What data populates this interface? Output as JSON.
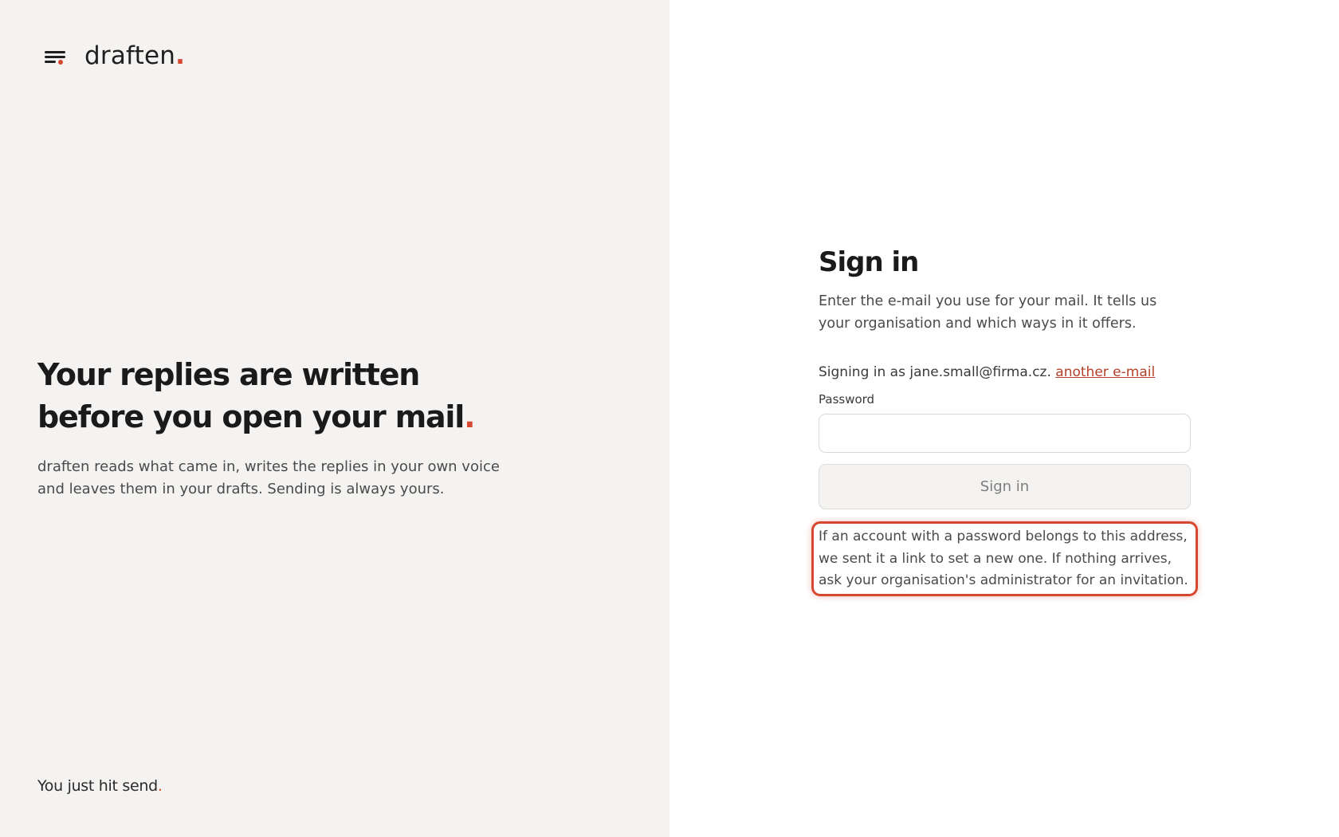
{
  "brand": {
    "name": "draften",
    "dot": ".",
    "icon": "menu-lines-icon"
  },
  "colors": {
    "accent": "#d6482f",
    "link": "#b3422a",
    "left_bg": "#f4f3f1"
  },
  "hero": {
    "title": "Your replies are written before you open your mail",
    "title_dot": ".",
    "subtitle": "draften reads what came in, writes the replies in your own voice and leaves them in your drafts. Sending is always yours."
  },
  "tagline": {
    "text": "You just hit send",
    "dot": "."
  },
  "signin": {
    "title": "Sign in",
    "description": "Enter the e-mail you use for your mail. It tells us your organisation and which ways in it offers.",
    "signing_as_prefix": "Signing in as jane.small@firma.cz.",
    "another_email_link": "another e-mail",
    "password_label": "Password",
    "password_value": "",
    "button_label": "Sign in",
    "notice": "If an account with a password belongs to this address, we sent it a link to set a new one. If nothing arrives, ask your organisation's administrator for an invitation."
  }
}
